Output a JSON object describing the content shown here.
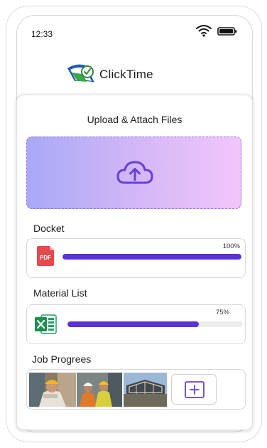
{
  "status_bar": {
    "time": "12:33",
    "icons": [
      "wifi-icon",
      "battery-icon"
    ]
  },
  "brand": {
    "name": "ClickTime",
    "logo_icon": "clicktime-logo-icon"
  },
  "upload_card": {
    "title": "Upload & Attach Files",
    "dropzone_icon": "cloud-upload-icon",
    "sections": [
      {
        "label": "Docket",
        "file_icon": "pdf-file-icon",
        "file_icon_text": "PDF",
        "progress_percent": 100,
        "progress_label": "100%"
      },
      {
        "label": "Material List",
        "file_icon": "excel-file-icon",
        "progress_percent": 75,
        "progress_label": "75%"
      },
      {
        "label": "Job Progrees",
        "thumbnails": [
          "engineer-photo",
          "workers-photo",
          "construction-site-photo"
        ],
        "add_icon": "add-photo-icon"
      }
    ]
  },
  "colors": {
    "accent": "#5a32d6",
    "dropzone_gradient_start": "#a8a9f7",
    "dropzone_gradient_end": "#f3c6fb",
    "pdf_red": "#e5484d",
    "excel_green": "#21a366"
  }
}
